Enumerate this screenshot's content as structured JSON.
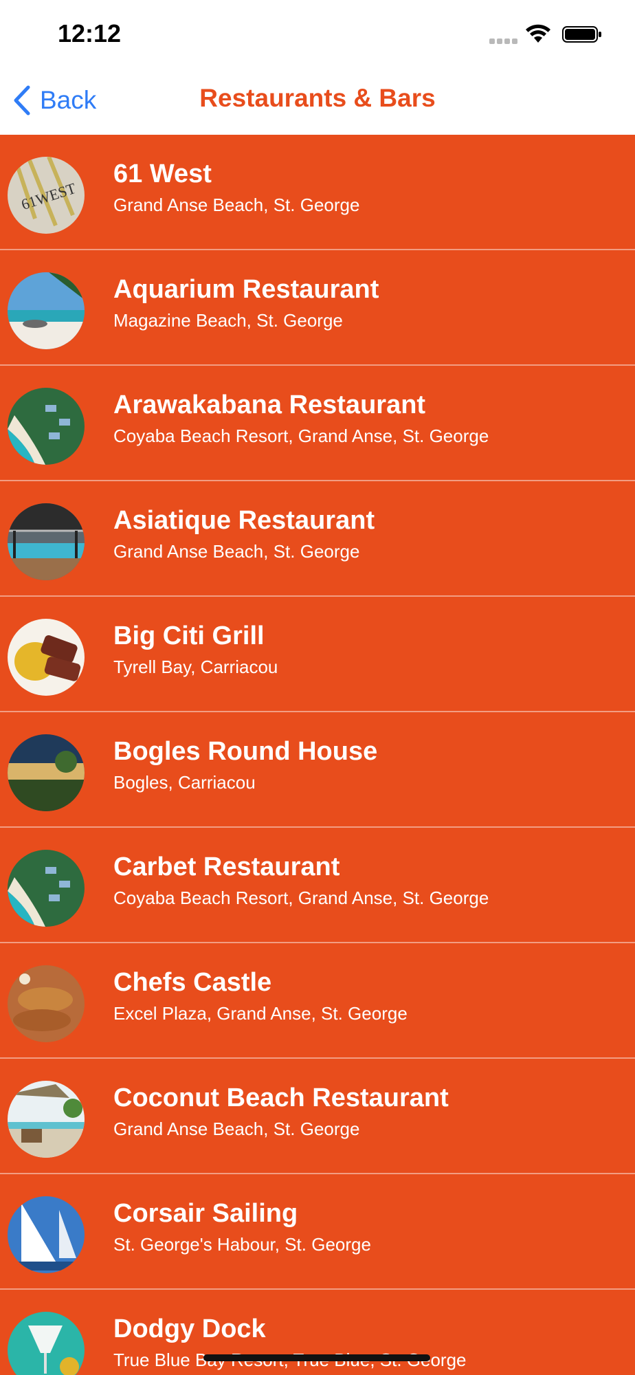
{
  "colors": {
    "accent": "#e84d1c",
    "back_blue": "#2f7cf6",
    "row_background": "#e84d1c",
    "text_on_accent": "#ffffff"
  },
  "status_bar": {
    "time": "12:12",
    "icons": [
      "signal-icon",
      "wifi-icon",
      "battery-icon"
    ]
  },
  "nav": {
    "back_label": "Back",
    "title": "Restaurants & Bars"
  },
  "restaurants": [
    {
      "name": "61 West",
      "location": "Grand Anse Beach, St. George",
      "thumbnail": "logo-sign-thumbnail"
    },
    {
      "name": "Aquarium Restaurant",
      "location": "Magazine Beach, St. George",
      "thumbnail": "beach-palm-thumbnail"
    },
    {
      "name": "Arawakabana Restaurant",
      "location": "Coyaba Beach Resort, Grand Anse, St. George",
      "thumbnail": "resort-aerial-thumbnail"
    },
    {
      "name": "Asiatique Restaurant",
      "location": "Grand Anse Beach, St. George",
      "thumbnail": "pool-pergola-thumbnail"
    },
    {
      "name": "Big Citi Grill",
      "location": "Tyrell Bay, Carriacou",
      "thumbnail": "food-plate-thumbnail"
    },
    {
      "name": "Bogles Round House",
      "location": "Bogles, Carriacou",
      "thumbnail": "garden-night-thumbnail"
    },
    {
      "name": "Carbet Restaurant",
      "location": "Coyaba Beach Resort, Grand Anse, St. George",
      "thumbnail": "resort-aerial-thumbnail"
    },
    {
      "name": "Chefs Castle",
      "location": "Excel Plaza, Grand Anse, St. George",
      "thumbnail": "fried-food-thumbnail"
    },
    {
      "name": "Coconut Beach Restaurant",
      "location": "Grand Anse Beach, St. George",
      "thumbnail": "beach-umbrella-thumbnail"
    },
    {
      "name": "Corsair Sailing",
      "location": "St. George's Habour, St. George",
      "thumbnail": "sailboat-thumbnail"
    },
    {
      "name": "Dodgy Dock",
      "location": "True Blue Bay Resort, True Blue, St. George",
      "thumbnail": "cocktail-thumbnail"
    }
  ]
}
